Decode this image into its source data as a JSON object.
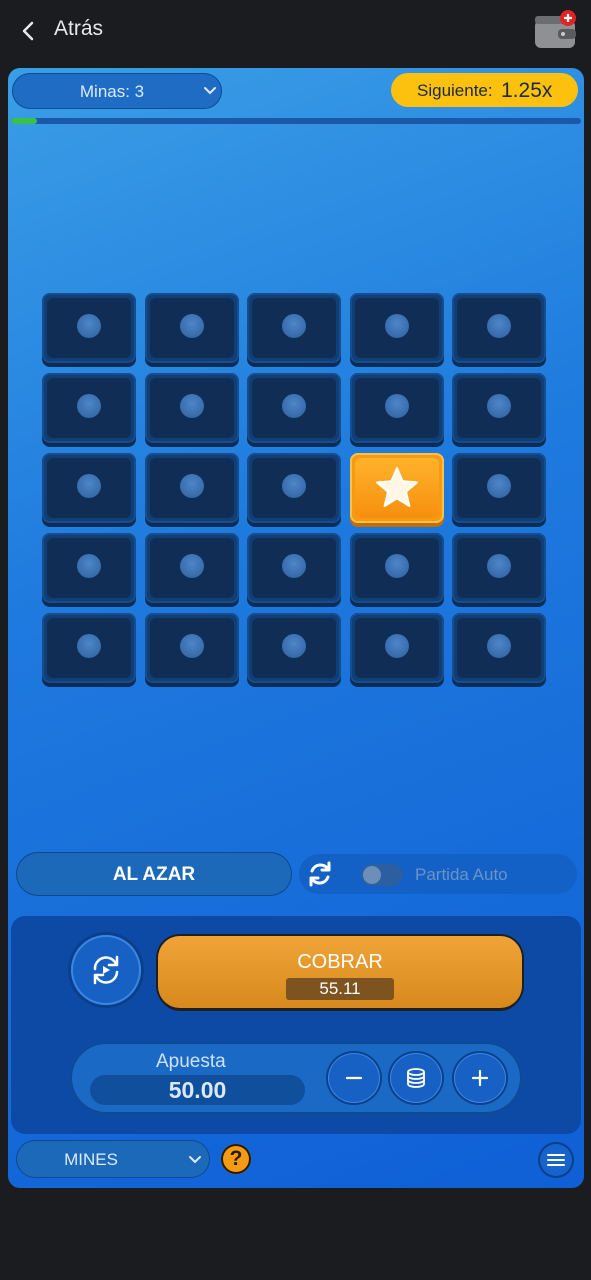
{
  "topbar": {
    "back_label": "Atrás",
    "icons": {
      "back": "chevron-left-icon",
      "wallet": "wallet-icon",
      "wallet_badge": "plus-badge-icon"
    }
  },
  "game": {
    "mines_selector_label": "Minas: 3",
    "next_multiplier": {
      "label": "Siguiente:",
      "value": "1.25x"
    },
    "progress_fraction": 0.045,
    "board": {
      "rows": 5,
      "cols": 5,
      "revealed": [
        {
          "row": 2,
          "col": 3,
          "content": "star"
        }
      ]
    },
    "random_button_label": "AL AZAR",
    "auto_play": {
      "label": "Partida Auto",
      "enabled": false
    },
    "cashout": {
      "label": "COBRAR",
      "amount": "55.11"
    },
    "bet": {
      "label": "Apuesta",
      "value": "50.00"
    },
    "game_selector_label": "MINES",
    "help_symbol": "?"
  },
  "colors": {
    "accent_yellow": "#fcc10f",
    "cash_orange": "#e59a2b",
    "star_orange": "#f59a12",
    "progress_green": "#39c04d"
  }
}
